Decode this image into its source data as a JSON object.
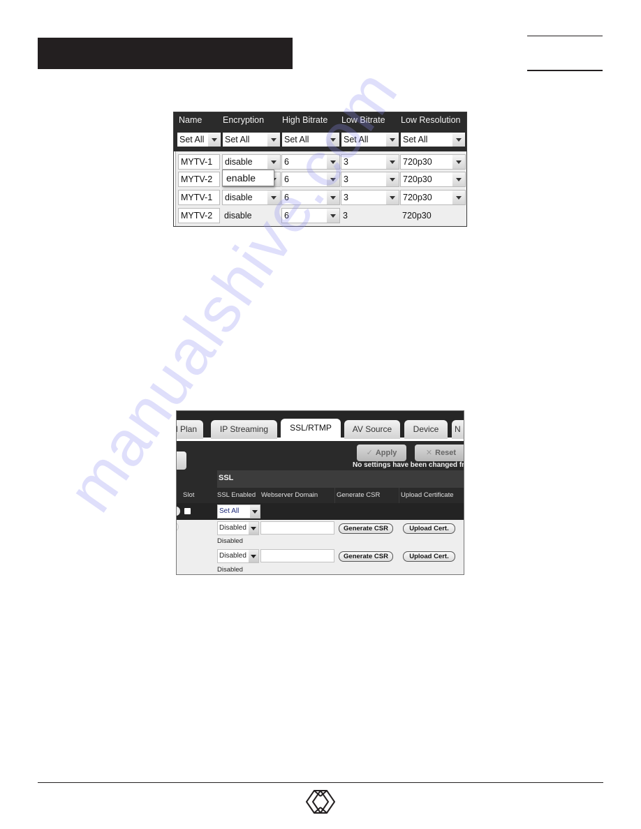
{
  "watermark": "manualshive.com",
  "screenshot1": {
    "columns": [
      "Name",
      "Encryption",
      "High Bitrate",
      "Low Bitrate",
      "Low Resolution"
    ],
    "set_all_label": "Set All",
    "rows": [
      {
        "name": "MYTV-1",
        "encryption": "disable",
        "high_bitrate": "6",
        "low_bitrate": "3",
        "low_resolution": "720p30"
      },
      {
        "name": "MYTV-2",
        "encryption": "",
        "high_bitrate": "6",
        "low_bitrate": "3",
        "low_resolution": "720p30"
      },
      {
        "name": "MYTV-1",
        "encryption": "disable",
        "high_bitrate": "6",
        "low_bitrate": "3",
        "low_resolution": "720p30"
      },
      {
        "name": "MYTV-2",
        "encryption": "disable",
        "high_bitrate": "6",
        "low_bitrate": "3",
        "low_resolution": "720p30"
      }
    ],
    "open_dropdown_option": "enable"
  },
  "screenshot2": {
    "tabs": [
      {
        "label": "l Plan",
        "active": false
      },
      {
        "label": "IP Streaming",
        "active": false
      },
      {
        "label": "SSL/RTMP",
        "active": true
      },
      {
        "label": "AV Source",
        "active": false
      },
      {
        "label": "Device",
        "active": false
      },
      {
        "label": "N",
        "active": false
      }
    ],
    "apply_label": "Apply",
    "reset_label": "Reset",
    "apply_icon": "check-icon",
    "reset_icon": "x-icon",
    "status_message": "No settings have been changed fro",
    "section_title": "SSL",
    "columns": [
      "Slot",
      "SSL Enabled",
      "Webserver Domain",
      "Generate CSR",
      "Upload Certificate"
    ],
    "set_all_label": "Set All",
    "rows": [
      {
        "ssl_enabled": "Disabled",
        "domain": "",
        "generate_label": "Generate CSR",
        "upload_label": "Upload Cert.",
        "state": "Disabled"
      },
      {
        "ssl_enabled": "Disabled",
        "domain": "",
        "generate_label": "Generate CSR",
        "upload_label": "Upload Cert.",
        "state": "Disabled"
      }
    ]
  },
  "colors": {
    "header_bar": "#231f20",
    "table_header_bg": "#2b2b2b",
    "table_body_bg": "#eeeeee",
    "watermark": "#8c8cf0"
  }
}
